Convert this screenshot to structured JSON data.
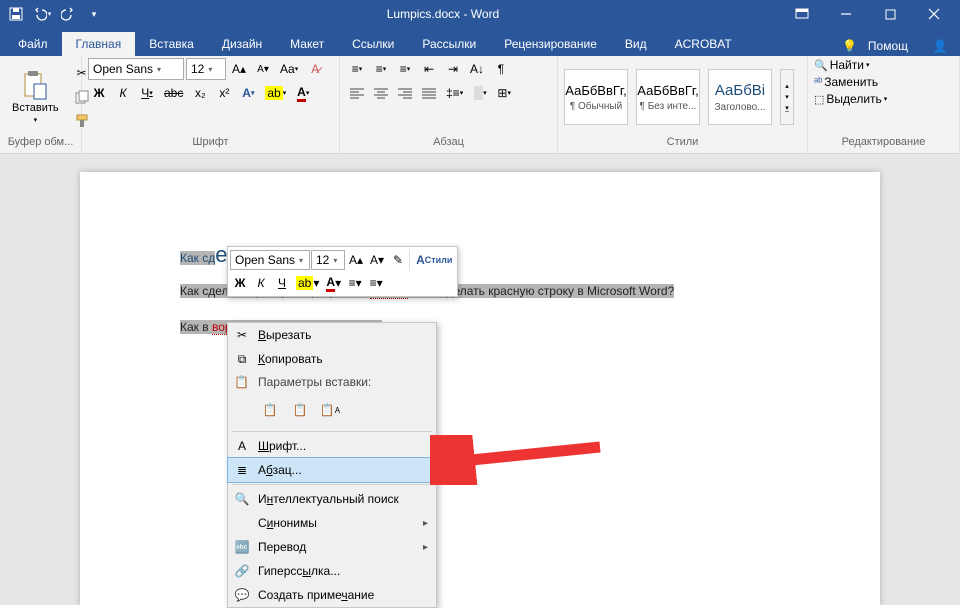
{
  "titlebar": {
    "title": "Lumpics.docx - Word"
  },
  "tabs": [
    "Файл",
    "Главная",
    "Вставка",
    "Дизайн",
    "Макет",
    "Ссылки",
    "Рассылки",
    "Рецензирование",
    "Вид",
    "ACROBAT"
  ],
  "active_tab": 1,
  "help": "Помощ",
  "ribbon": {
    "clipboard": {
      "paste": "Вставить",
      "label": "Буфер обм..."
    },
    "font": {
      "name": "Open Sans",
      "size": "12",
      "label": "Шрифт",
      "bold": "Ж",
      "italic": "К",
      "underline": "Ч",
      "strike": "abc",
      "sub": "x₂",
      "sup": "x²"
    },
    "paragraph": {
      "label": "Абзац"
    },
    "styles": {
      "label": "Стили",
      "items": [
        {
          "preview": "АаБбВвГг,",
          "name": "¶ Обычный"
        },
        {
          "preview": "АаБбВвГг,",
          "name": "¶ Без инте..."
        },
        {
          "preview": "АаБбВі",
          "name": "Заголово..."
        }
      ]
    },
    "editing": {
      "label": "Редактирование",
      "find": "Найти",
      "replace": "Заменить",
      "select": "Выделить"
    }
  },
  "document": {
    "title": "Как сделать красную строку",
    "para": "Как сделать красную строку в MS WORD? Как сделать красную строку в Microsoft Word?",
    "para2": "Как в ворде сделать красную строку"
  },
  "minibar": {
    "font": "Open Sans",
    "size": "12",
    "styles": "Стили"
  },
  "ctx": {
    "cut": "Вырезать",
    "copy": "Копировать",
    "paste_header": "Параметры вставки:",
    "font": "Шрифт...",
    "paragraph": "Абзац...",
    "smart": "Интеллектуальный поиск",
    "synonyms": "Синонимы",
    "translate": "Перевод",
    "hyperlink": "Гиперссылка...",
    "comment": "Создать примечание"
  }
}
